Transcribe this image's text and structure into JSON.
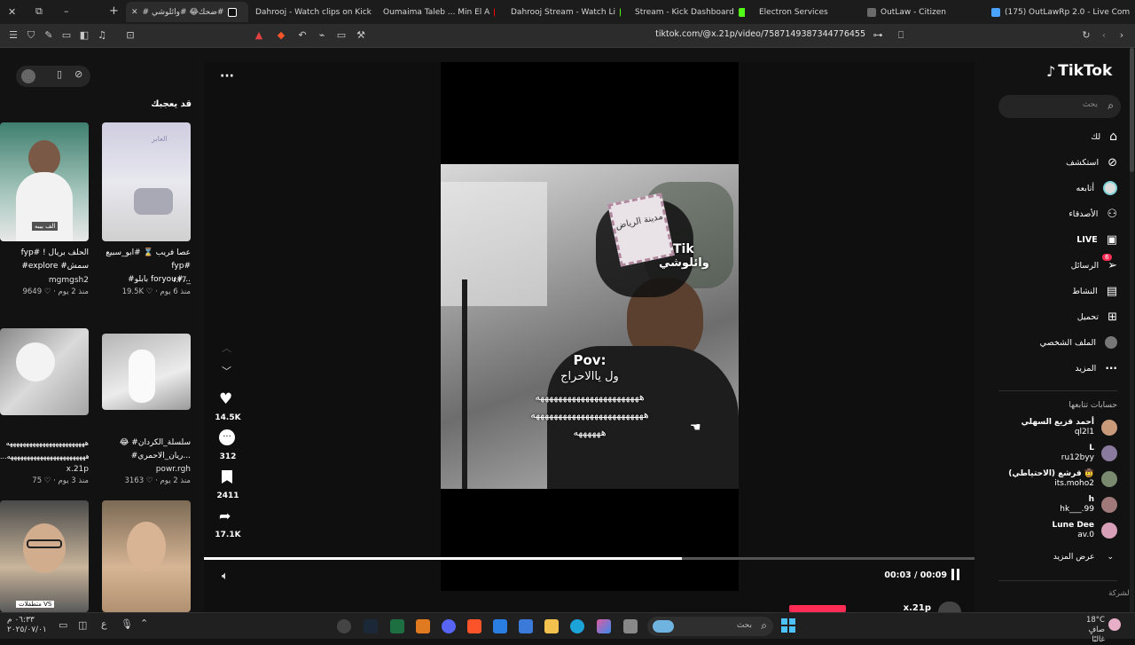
{
  "browser": {
    "tabs": [
      {
        "label": "#ضحك😂 #وائلوشي #",
        "active": true,
        "color": "#ffffff"
      },
      {
        "label": "Dahrooj - Watch clips on Kick",
        "color": "#53fc18"
      },
      {
        "label": "Oumaima Taleb ... Min El A",
        "color": "#ff0000"
      },
      {
        "label": "Dahrooj Stream - Watch Li",
        "color": "#53fc18"
      },
      {
        "label": "Stream - Kick Dashboard",
        "color": "#53fc18"
      },
      {
        "label": "Electron Services",
        "color": "#4a7bd0"
      },
      {
        "label": "OutLaw - Citizen",
        "color": "#6a6a6a"
      },
      {
        "label": "(175) OutLawRp 2.0 - Live Com",
        "color": "#4aa3ff"
      }
    ],
    "url": "tiktok.com/@x.21p/video/7587149387344776455"
  },
  "sidebar_left": {
    "heading": "قد يعجبك",
    "items": [
      {
        "title_lines": [
          "fyp# ! الحلف بريال",
          "#explore #سمش"
        ],
        "user": "mgmgsh2",
        "meta": "9649 ♡ · منذ 2 يوم",
        "thumb_label": "الف بيبه",
        "colors": [
          "#3f7f6e",
          "#e0e0e0"
        ]
      },
      {
        "title_lines": [
          "عصا فريب ⌛ #ابو_سبيع fyp#",
          "#بابلو foryou#..."
        ],
        "user": "r.r7_",
        "meta": "19.5K ♡ · منذ 6 يوم",
        "thumb_label": "العابر",
        "colors": [
          "#c8c6d8",
          "#eeeeee"
        ]
      },
      {
        "title_lines": [
          "ههههههههههههههههههههههههه",
          "...ههههههههههههههههههههههههه"
        ],
        "user": "x.21p",
        "meta": "75 ♡ · منذ 3 يوم",
        "thumb_label": "",
        "colors": [
          "#9a9a9a",
          "#d6d6d6"
        ]
      },
      {
        "title_lines": [
          "😂 #سلسلة_الكردان",
          "#ريان_الاحمري..."
        ],
        "user": "powr.rgh",
        "meta": "3163 ♡ · منذ 2 يوم",
        "thumb_label": "",
        "colors": [
          "#b6b6b6",
          "#e8e8e8"
        ]
      },
      {
        "title_lines": [],
        "user": "",
        "meta": "",
        "thumb_label": "متطفلات VS",
        "colors": [
          "#3a3a3a",
          "#d9c4a8"
        ]
      },
      {
        "title_lines": [],
        "user": "",
        "meta": "",
        "thumb_label": "",
        "colors": [
          "#6f5a45",
          "#d8b896"
        ]
      }
    ]
  },
  "player": {
    "more_label": "···",
    "overlay": {
      "stamp": "مدينة الرياض",
      "tik": "Tik",
      "name": "وائلوشي",
      "pov": "Pov:",
      "line1": "ول ياالاحراج",
      "line2": "هههههههههههههههههههههههه",
      "line3": "هههههههههههههههههههههههههه",
      "line4": "ههههههه"
    },
    "actions": {
      "likes": "14.5K",
      "comments": "312",
      "saves": "2411",
      "shares": "17.1K"
    },
    "time": "00:03 / 00:09",
    "progress": 0.62,
    "bottom_user": "x.21p"
  },
  "sidebar_right": {
    "logo": "TikTok",
    "search_placeholder": "بحث",
    "nav": [
      {
        "label": "لك",
        "icon": "home-icon"
      },
      {
        "label": "استكشف",
        "icon": "compass-icon"
      },
      {
        "label": "أتابعه",
        "icon": "following-icon"
      },
      {
        "label": "الأصدقاء",
        "icon": "friends-icon"
      },
      {
        "label": "LIVE",
        "icon": "live-icon"
      },
      {
        "label": "الرسائل",
        "icon": "messages-icon",
        "badge": "6"
      },
      {
        "label": "النشاط",
        "icon": "activity-icon"
      },
      {
        "label": "تحميل",
        "icon": "upload-icon"
      },
      {
        "label": "الملف الشخصي",
        "icon": "profile-icon"
      },
      {
        "label": "المزيد",
        "icon": "more-icon"
      }
    ],
    "following_heading": "حسابات تتابعها",
    "following": [
      {
        "name": "أحمد قزيع السهلي",
        "handle": "ql2l1",
        "color": "#c89a7a"
      },
      {
        "name": "L",
        "handle": "ru12byy",
        "color": "#8a7a9e"
      },
      {
        "name": "قرشع (الاحتياطي) 🤠",
        "handle": "its.moho2",
        "color": "#7a8a6e"
      },
      {
        "name": "h",
        "handle": "hk___.99",
        "color": "#a07a7a"
      },
      {
        "name": "Lune Dee",
        "handle": "av.0",
        "color": "#d8a0b8"
      }
    ],
    "show_more": "عرض المزيد",
    "company": "الشركة"
  },
  "taskbar": {
    "weather_temp": "18°C",
    "weather_desc": "صافٍ غالبًا",
    "search_placeholder": "بحث",
    "clock_time": "٠٦:٣٣ م",
    "clock_date": "٢٠٢٥/٠٧/٠١",
    "lang": "ع"
  }
}
